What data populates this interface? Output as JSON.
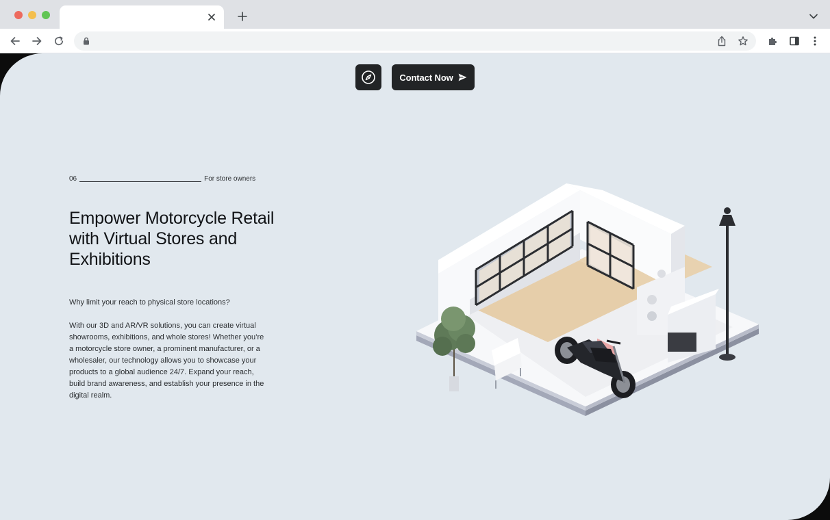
{
  "browser": {
    "tab_title": "",
    "url": "",
    "icons": [
      "close-icon",
      "plus-icon",
      "chevron-down-icon",
      "back-arrow-icon",
      "forward-arrow-icon",
      "reload-icon",
      "lock-icon",
      "share-icon",
      "star-icon",
      "puzzle-icon",
      "side-panel-icon",
      "kebab-menu-icon"
    ]
  },
  "nav": {
    "compass_icon": "compass-icon",
    "contact_label": "Contact Now",
    "contact_icon": "send-arrow-icon"
  },
  "section": {
    "number": "06",
    "label": "For store owners"
  },
  "hero": {
    "title": "Empower Motorcycle Retail with Virtual Stores and Exhibitions",
    "intro": "Why limit your reach to physical store locations?",
    "body": "With our 3D and AR/VR solutions, you can create virtual showrooms, exhibitions, and whole stores! Whether you’re a motorcycle store owner, a prominent manufacturer, or a wholesaler, our technology allows you to showcase your products to a global audience 24/7. Expand your reach, build brand awareness, and establish your presence in the digital realm."
  },
  "colors": {
    "page_background": "#e1e8ee",
    "button_dark": "#222426",
    "text_dark": "#111316",
    "frame_black": "#0c0c0c"
  }
}
